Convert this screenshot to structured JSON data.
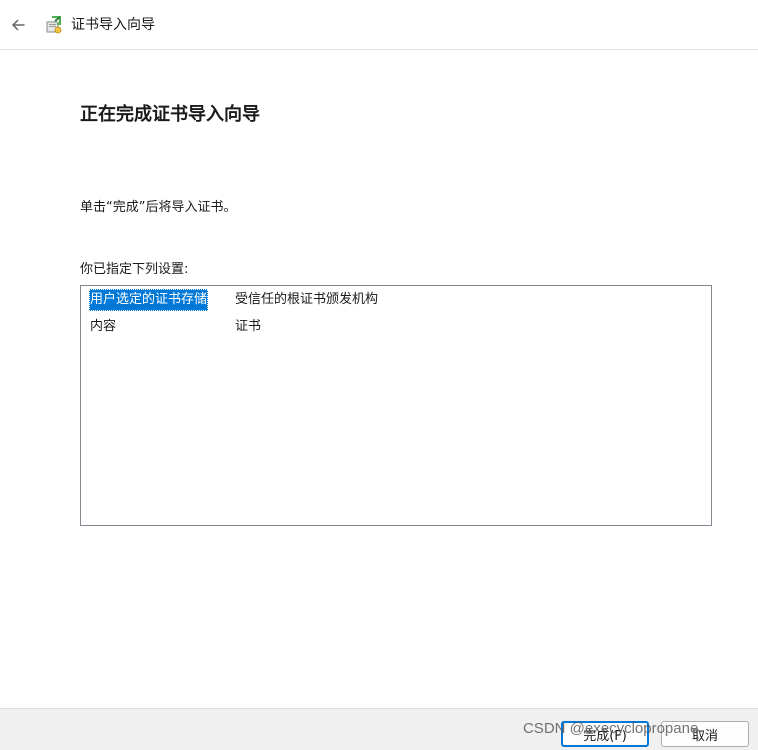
{
  "window": {
    "title": "证书导入向导"
  },
  "main": {
    "heading": "正在完成证书导入向导",
    "instruction": "单击“完成”后将导入证书。",
    "settings_label": "你已指定下列设置:",
    "settings": [
      {
        "key": "用户选定的证书存储",
        "value": "受信任的根证书颁发机构",
        "selected": true
      },
      {
        "key": "内容",
        "value": "证书",
        "selected": false
      }
    ]
  },
  "footer": {
    "finish_label": "完成(F)",
    "cancel_label": "取消"
  },
  "watermark": "CSDN @execyclopropane",
  "colors": {
    "selection": "#0078d7",
    "default_button_border": "#0078d7",
    "footer_bg": "#f0f0f0"
  }
}
